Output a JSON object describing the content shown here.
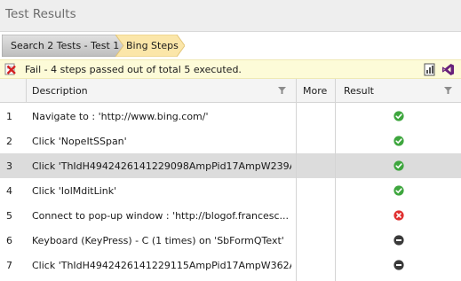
{
  "window": {
    "title": "Test Results"
  },
  "breadcrumb": [
    {
      "label": "Search 2 Tests - Test 1"
    },
    {
      "label": "Bing Steps"
    }
  ],
  "status": {
    "text": "Fail - 4 steps passed out of total 5 executed.",
    "icon": "fail-icon",
    "tools": [
      "report-icon",
      "visual-studio-icon"
    ]
  },
  "table": {
    "columns": [
      "Description",
      "More",
      "Result"
    ],
    "rows": [
      {
        "num": "1",
        "description": "Navigate to : 'http://www.bing.com/'",
        "result": "pass"
      },
      {
        "num": "2",
        "description": "Click 'NopeItSSpan'",
        "result": "pass"
      },
      {
        "num": "3",
        "description": "Click 'ThIdH4942426141229098AmpPid17AmpW239A...",
        "result": "pass",
        "selected": true
      },
      {
        "num": "4",
        "description": "Click 'IolMditLink'",
        "result": "pass"
      },
      {
        "num": "5",
        "description": "Connect to pop-up window : 'http://blogof.francesc...",
        "result": "fail"
      },
      {
        "num": "6",
        "description": "Keyboard (KeyPress) - C (1 times) on 'SbFormQText'",
        "result": "not-run"
      },
      {
        "num": "7",
        "description": "Click 'ThIdH4942426141229115AmpPid17AmpW362A...",
        "result": "not-run"
      }
    ]
  },
  "colors": {
    "pass": "#3ea63e",
    "fail": "#e03030",
    "not_run": "#3a3a3a",
    "crumb_active": "#fbe6a9",
    "status_bg": "#fdfbd8"
  }
}
